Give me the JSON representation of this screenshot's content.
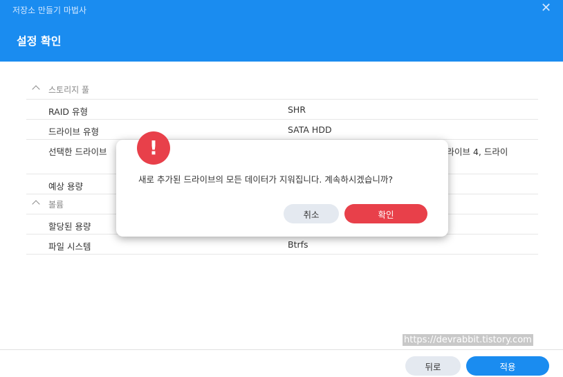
{
  "window": {
    "title": "저장소 만들기 마법사",
    "close_glyph": "✕",
    "step_title": "설정 확인"
  },
  "summary": {
    "section_storage": "스토리지 풀",
    "raid_label": "RAID 유형",
    "raid_value": "SHR",
    "drive_type_label": "드라이브 유형",
    "drive_type_value": "SATA HDD",
    "selected_label": "선택한 드라이브",
    "selected_value_visible": "드라이브 4, 드라이",
    "capacity_label": "예상 용량",
    "section_volume": "볼륨",
    "allocated_label": "할당된 용량",
    "fs_label": "파일 시스템",
    "fs_value": "Btrfs"
  },
  "dialog": {
    "icon_glyph": "!",
    "message": "새로 추가된 드라이브의 모든 데이터가 지워집니다. 계속하시겠습니까?",
    "cancel_label": "취소",
    "ok_label": "확인"
  },
  "footer": {
    "back_label": "뒤로",
    "apply_label": "적용"
  },
  "watermark": "https://devrabbit.tistory.com",
  "colors": {
    "header_blue": "#1a8cf0",
    "alert_red": "#e8404a",
    "secondary_btn": "#e4e9f0"
  }
}
